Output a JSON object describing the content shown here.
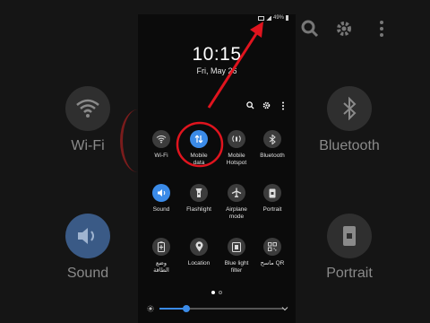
{
  "status_bar": {
    "battery": "49%"
  },
  "clock": {
    "time": "10:15",
    "date": "Fri, May 26"
  },
  "header_actions": [
    {
      "icon": "search-icon"
    },
    {
      "icon": "gear-icon"
    },
    {
      "icon": "more-vert-icon"
    }
  ],
  "tiles": [
    {
      "name": "wifi",
      "label": "Wi-Fi",
      "icon": "wifi-icon",
      "active": false
    },
    {
      "name": "mobile-data",
      "label": "Mobile\ndata",
      "icon": "data-arrows-icon",
      "active": true
    },
    {
      "name": "mobile-hotspot",
      "label": "Mobile\nHotspot",
      "icon": "hotspot-icon",
      "active": false
    },
    {
      "name": "bluetooth",
      "label": "Bluetooth",
      "icon": "bluetooth-icon",
      "active": false
    },
    {
      "name": "sound",
      "label": "Sound",
      "icon": "speaker-icon",
      "active": true
    },
    {
      "name": "flashlight",
      "label": "Flashlight",
      "icon": "flashlight-icon",
      "active": false
    },
    {
      "name": "airplane-mode",
      "label": "Airplane\nmode",
      "icon": "airplane-icon",
      "active": false
    },
    {
      "name": "portrait",
      "label": "Portrait",
      "icon": "portrait-lock-icon",
      "active": false
    },
    {
      "name": "power-saving",
      "label": "وضع\nالطاقة",
      "icon": "battery-saver-icon",
      "active": false
    },
    {
      "name": "location",
      "label": "Location",
      "icon": "location-pin-icon",
      "active": false
    },
    {
      "name": "blue-light-filter",
      "label": "Blue light\nfilter",
      "icon": "blue-light-icon",
      "active": false
    },
    {
      "name": "qr-scanner",
      "label": "ماسح QR",
      "icon": "qr-code-icon",
      "active": false
    }
  ],
  "page_indicator": {
    "current": 1,
    "total": 2
  },
  "brightness": {
    "level": 0.22
  },
  "background_tiles": {
    "wifi_label": "Wi-Fi",
    "bluetooth_label": "Bluetooth",
    "sound_label": "Sound",
    "portrait_label": "Portrait"
  },
  "colors": {
    "accent": "#3b8be8",
    "annotation": "#e0141e",
    "panel_bg": "#0b0b0b"
  }
}
